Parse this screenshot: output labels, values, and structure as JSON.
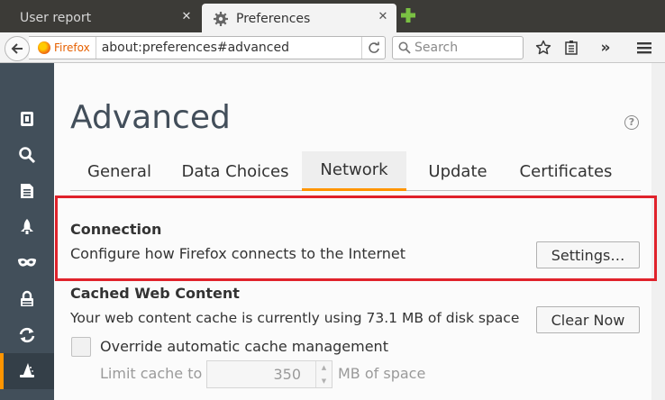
{
  "browser": {
    "tabs": [
      {
        "title": "User report",
        "active": false
      },
      {
        "title": "Preferences",
        "active": true
      }
    ],
    "identity_label": "Firefox",
    "url": "about:preferences#advanced",
    "search_placeholder": "Search"
  },
  "page": {
    "title": "Advanced",
    "tabs": [
      "General",
      "Data Choices",
      "Network",
      "Update",
      "Certificates"
    ],
    "selected_tab": "Network"
  },
  "connection": {
    "title": "Connection",
    "description": "Configure how Firefox connects to the Internet",
    "settings_button": "Settings…"
  },
  "cache": {
    "title": "Cached Web Content",
    "usage_text": "Your web content cache is currently using 73.1 MB of disk space",
    "clear_button": "Clear Now",
    "override_label": "Override automatic cache management",
    "override_checked": false,
    "limit_label": "Limit cache to",
    "limit_value": "350",
    "limit_unit": "MB of space"
  },
  "sidebar": {
    "items": [
      "general",
      "search",
      "content",
      "applications",
      "privacy",
      "security",
      "sync",
      "advanced"
    ],
    "selected": "advanced"
  },
  "colors": {
    "accent": "#ff9500",
    "sidebar": "#424f5a",
    "highlight": "#e0222b"
  }
}
